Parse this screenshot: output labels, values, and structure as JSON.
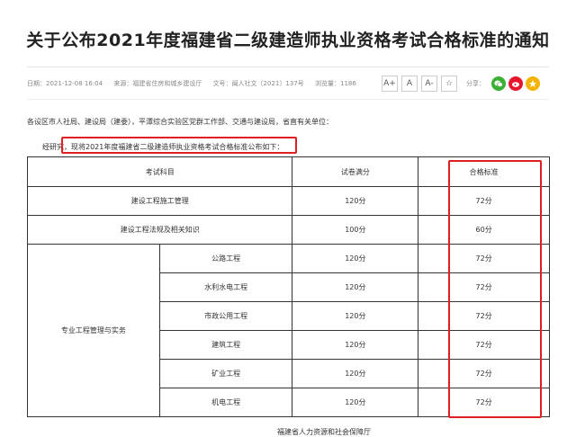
{
  "title": "关于公布2021年度福建省二级建造师执业资格考试合格标准的通知",
  "meta": {
    "date": "日期：2021-12-08 16:04",
    "source": "来源：福建省住房和城乡建设厅",
    "doc_no": "文号：闽人社文〔2021〕137号",
    "views": "浏览量：1186"
  },
  "tools": {
    "font_up": "A+",
    "font_normal": "A",
    "font_down": "A-",
    "share_label": "分享："
  },
  "colors": {
    "highlight": "#e02020",
    "wechat": "#3cb034",
    "weibo": "#e6162d",
    "qzone": "#f5b400"
  },
  "body": {
    "para1": "各设区市人社局、建设局（建委），平潭综合实验区党群工作部、交通与建设局，省直有关单位：",
    "para2": "经研究，现将2021年度福建省二级建造师执业资格考试合格标准公布如下："
  },
  "table": {
    "headers": [
      "考试科目",
      "试卷满分",
      "合格标准"
    ],
    "rows_simple": [
      {
        "subject": "建设工程施工管理",
        "full": "120分",
        "pass": "72分"
      },
      {
        "subject": "建设工程法规及相关知识",
        "full": "100分",
        "pass": "60分"
      }
    ],
    "group_label": "专业工程管理与实务",
    "rows_group": [
      {
        "subject": "公路工程",
        "full": "120分",
        "pass": "72分"
      },
      {
        "subject": "水利水电工程",
        "full": "120分",
        "pass": "72分"
      },
      {
        "subject": "市政公用工程",
        "full": "120分",
        "pass": "72分"
      },
      {
        "subject": "建筑工程",
        "full": "120分",
        "pass": "72分"
      },
      {
        "subject": "矿业工程",
        "full": "120分",
        "pass": "72分"
      },
      {
        "subject": "机电工程",
        "full": "120分",
        "pass": "72分"
      }
    ]
  },
  "footer": "福建省人力资源和社会保障厅"
}
